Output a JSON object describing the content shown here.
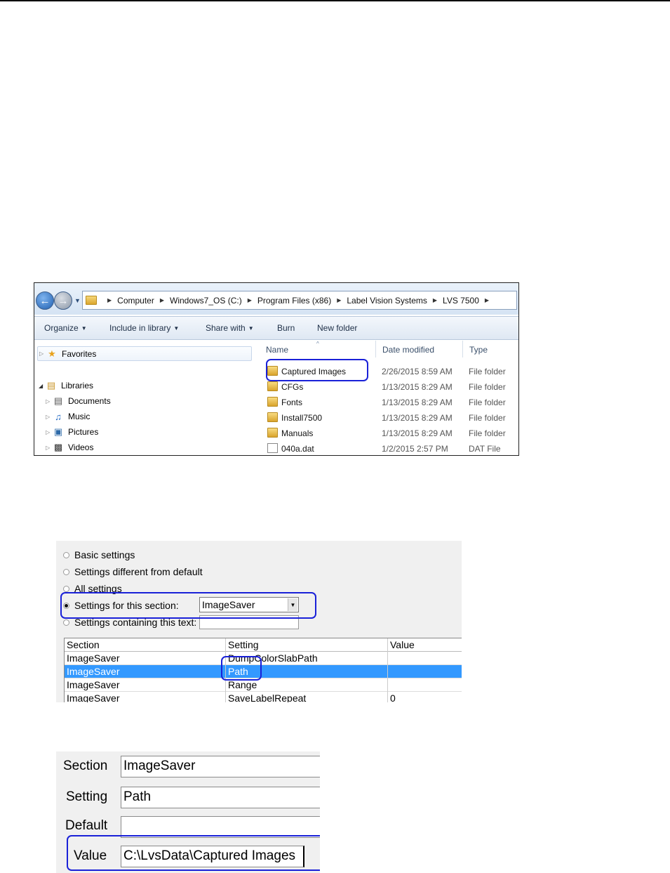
{
  "explorer": {
    "breadcrumbs": [
      "Computer",
      "Windows7_OS (C:)",
      "Program Files (x86)",
      "Label Vision Systems",
      "LVS 7500"
    ],
    "toolbar": {
      "organize": "Organize",
      "include_in_library": "Include in library",
      "share_with": "Share with",
      "burn": "Burn",
      "new_folder": "New folder"
    },
    "nav": {
      "favorites": "Favorites",
      "libraries": "Libraries",
      "documents": "Documents",
      "music": "Music",
      "pictures": "Pictures",
      "videos": "Videos"
    },
    "columns": {
      "name": "Name",
      "date_modified": "Date modified",
      "type": "Type"
    },
    "files": [
      {
        "name": "Captured Images",
        "date": "2/26/2015 8:59 AM",
        "type": "File folder",
        "icon": "folder-icon"
      },
      {
        "name": "CFGs",
        "date": "1/13/2015 8:29 AM",
        "type": "File folder",
        "icon": "folder-icon"
      },
      {
        "name": "Fonts",
        "date": "1/13/2015 8:29 AM",
        "type": "File folder",
        "icon": "folder-icon"
      },
      {
        "name": "Install7500",
        "date": "1/13/2015 8:29 AM",
        "type": "File folder",
        "icon": "folder-icon"
      },
      {
        "name": "Manuals",
        "date": "1/13/2015 8:29 AM",
        "type": "File folder",
        "icon": "folder-icon"
      },
      {
        "name": "040a.dat",
        "date": "1/2/2015 2:57 PM",
        "type": "DAT File",
        "icon": "file-icon"
      }
    ]
  },
  "settings": {
    "options": {
      "basic": "Basic settings",
      "different": "Settings different from default",
      "all": "All settings",
      "section": "Settings for this section:",
      "containing": "Settings containing this text:"
    },
    "section_value": "ImageSaver",
    "filter_text": "",
    "grid": {
      "headers": [
        "Section",
        "Setting",
        "Value"
      ],
      "rows": [
        [
          "ImageSaver",
          "DumpColorSlabPath",
          ""
        ],
        [
          "ImageSaver",
          "Path",
          ""
        ],
        [
          "ImageSaver",
          "Range",
          ""
        ],
        [
          "ImageSaver",
          "SaveLabelRepeat",
          "0"
        ]
      ]
    }
  },
  "detail": {
    "section_label": "Section",
    "section_value": "ImageSaver",
    "setting_label": "Setting",
    "setting_value": "Path",
    "default_label": "Default",
    "default_value": "",
    "value_label": "Value",
    "value_value": "C:\\LvsData\\Captured Images"
  },
  "colors": {
    "highlight_outline": "#1a21d8",
    "selected_row": "#3399ff"
  }
}
